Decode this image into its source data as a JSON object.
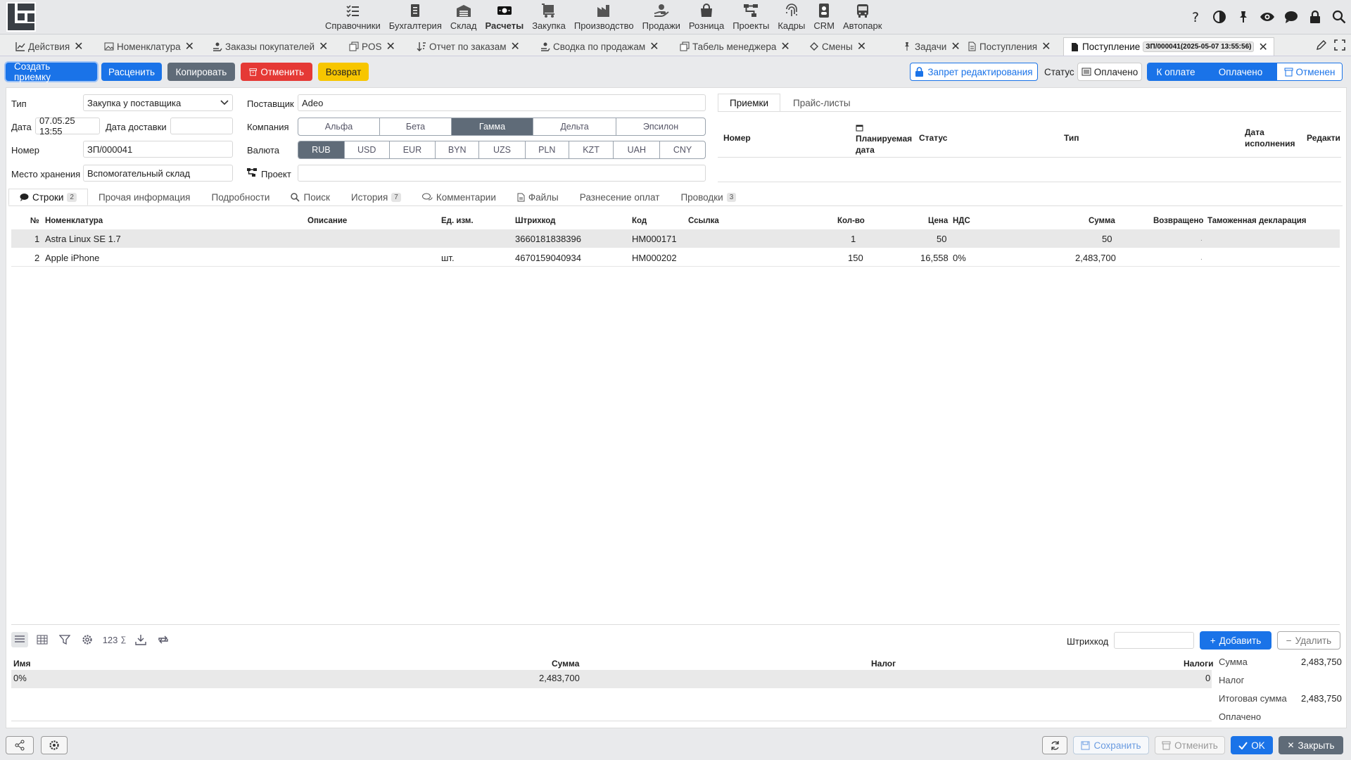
{
  "topnav": {
    "items": [
      {
        "label": "Справочники",
        "icon": "checklist-icon"
      },
      {
        "label": "Бухгалтерия",
        "icon": "ledger-icon"
      },
      {
        "label": "Склад",
        "icon": "warehouse-icon"
      },
      {
        "label": "Расчеты",
        "icon": "cash-icon"
      },
      {
        "label": "Закупка",
        "icon": "cart-icon"
      },
      {
        "label": "Производство",
        "icon": "factory-icon"
      },
      {
        "label": "Продажи",
        "icon": "hand-coins-icon"
      },
      {
        "label": "Розница",
        "icon": "shopping-bag-icon"
      },
      {
        "label": "Проекты",
        "icon": "project-tree-icon"
      },
      {
        "label": "Кадры",
        "icon": "fingerprint-icon"
      },
      {
        "label": "CRM",
        "icon": "contact-card-icon"
      },
      {
        "label": "Автопарк",
        "icon": "bus-icon"
      }
    ],
    "right_icons": [
      "help-icon",
      "contrast-icon",
      "pin-icon",
      "eye-icon",
      "chat-icon",
      "lock-icon",
      "search-icon"
    ]
  },
  "tabs": {
    "items": [
      {
        "label": "Действия"
      },
      {
        "label": "Номенклатура"
      },
      {
        "label": "Заказы покупателей"
      },
      {
        "label": "POS"
      },
      {
        "label": "Отчет по заказам"
      },
      {
        "label": "Сводка по продажам"
      },
      {
        "label": "Табель менеджера"
      },
      {
        "label": "Смены"
      },
      {
        "label": "Задачи"
      },
      {
        "label": "Поступления"
      },
      {
        "label": "Поступление",
        "number": "ЗП/000041(2025-05-07 13:55:56)"
      }
    ]
  },
  "actions": {
    "create_receipt": "Создать приемку",
    "reprice": "Расценить",
    "copy": "Копировать",
    "cancel": "Отменить",
    "return": "Возврат",
    "edit_lock": "Запрет редактирования",
    "status_label": "Статус",
    "status_value": "Оплачено",
    "status_segments": [
      "К оплате",
      "Оплачено",
      "Отменен"
    ]
  },
  "form": {
    "type_label": "Тип",
    "type_value": "Закупка у поставщика",
    "date_label": "Дата",
    "date_value": "07.05.25 13:55",
    "delivery_label": "Дата доставки",
    "delivery_value": "",
    "number_label": "Номер",
    "number_value": "ЗП/000041",
    "storage_label": "Место хранения",
    "storage_value": "Вспомогательный склад",
    "supplier_label": "Поставщик",
    "supplier_value": "Adeo",
    "company_label": "Компания",
    "companies": [
      "Альфа",
      "Бета",
      "Гамма",
      "Дельта",
      "Эпсилон"
    ],
    "company_selected": "Гамма",
    "currency_label": "Валюта",
    "currencies": [
      "RUB",
      "USD",
      "EUR",
      "BYN",
      "UZS",
      "PLN",
      "KZT",
      "UAH",
      "CNY"
    ],
    "currency_selected": "RUB",
    "project_label": "Проект",
    "project_value": ""
  },
  "right_panel": {
    "tabs": [
      "Приемки",
      "Прайс-листы"
    ],
    "columns": {
      "number": "Номер",
      "planned_line1": "Планируемая",
      "planned_line2": "дата",
      "status": "Статус",
      "type": "Тип",
      "exec_line1": "Дата",
      "exec_line2": "исполнения",
      "edit": "Редакти"
    }
  },
  "subtabs": [
    {
      "label": "Строки",
      "badge": "2"
    },
    {
      "label": "Прочая информация",
      "badge": ""
    },
    {
      "label": "Подробности",
      "badge": ""
    },
    {
      "label": "Поиск",
      "badge": ""
    },
    {
      "label": "История",
      "badge": "7"
    },
    {
      "label": "Комментарии",
      "badge": ""
    },
    {
      "label": "Файлы",
      "badge": ""
    },
    {
      "label": "Разнесение оплат",
      "badge": ""
    },
    {
      "label": "Проводки",
      "badge": "3"
    }
  ],
  "grid": {
    "headers": {
      "no": "№",
      "item": "Номенклатура",
      "description": "Описание",
      "unit": "Ед. изм.",
      "barcode": "Штрихкод",
      "code": "Код",
      "link": "Ссылка",
      "qty": "Кол-во",
      "price": "Цена",
      "vat": "НДС",
      "sum": "Сумма",
      "returned": "Возвращено",
      "customs": "Таможенная декларация"
    },
    "rows": [
      {
        "no": "1",
        "item": "Astra Linux SE 1.7",
        "description": "",
        "unit": "",
        "barcode": "3660181838396",
        "code": "НМ000171",
        "link": "",
        "qty": "1",
        "price": "50",
        "vat": "",
        "sum": "50",
        "returned": "",
        "customs": "."
      },
      {
        "no": "2",
        "item": "Apple iPhone",
        "description": "",
        "unit": "шт.",
        "barcode": "4670159040934",
        "code": "НМ000202",
        "link": "",
        "qty": "150",
        "price": "16,558",
        "vat": "0%",
        "sum": "2,483,700",
        "returned": "",
        "customs": "."
      }
    ]
  },
  "bottom": {
    "barcode_label": "Штрихкод",
    "add_button": "Добавить",
    "delete_button": "Удалить",
    "tool_text": "123",
    "tax_headers": {
      "name": "Имя",
      "sum": "Сумма",
      "tax": "Налог",
      "taxes": "Налоги"
    },
    "tax_row": {
      "name": "0%",
      "sum": "2,483,700",
      "tax": "",
      "taxes": "0"
    },
    "summary": [
      {
        "label": "Сумма",
        "value": "2,483,750"
      },
      {
        "label": "Налог",
        "value": ""
      },
      {
        "label": "Итоговая сумма",
        "value": "2,483,750"
      },
      {
        "label": "Оплачено",
        "value": ""
      }
    ]
  },
  "footer": {
    "save": "Сохранить",
    "cancel": "Отменить",
    "ok": "OK",
    "close": "Закрыть"
  },
  "colors": {
    "accent": "#1a73e8",
    "danger": "#e53935",
    "warning": "#f7c600",
    "neutral": "#5f6b78"
  }
}
